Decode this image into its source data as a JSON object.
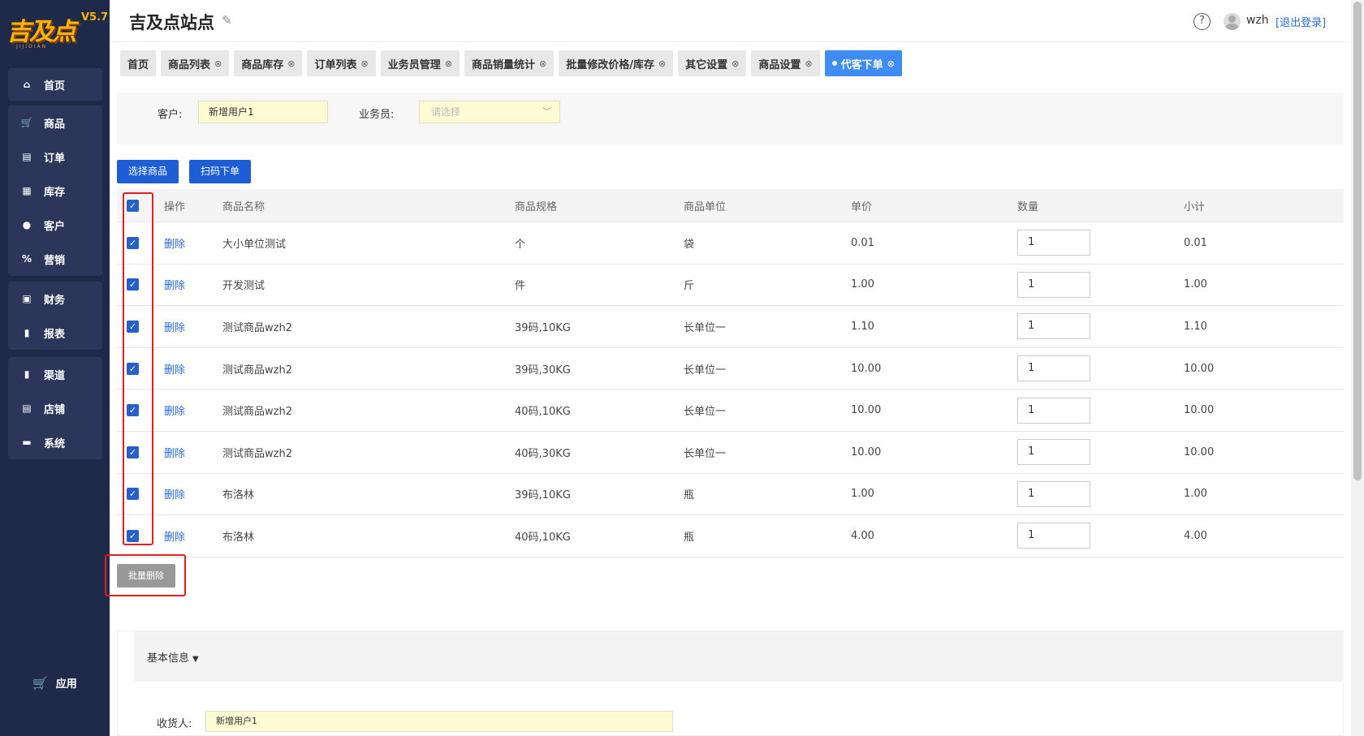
{
  "brand": {
    "logo_text": "吉及点",
    "version": "V5.7",
    "logo_sub": "JIJIDIAN"
  },
  "sidebar": {
    "home": {
      "label": "首页",
      "icon": "home-icon"
    },
    "group1": [
      {
        "label": "商品",
        "icon": "cart-icon"
      },
      {
        "label": "订单",
        "icon": "order-icon"
      },
      {
        "label": "库存",
        "icon": "grid-icon"
      },
      {
        "label": "客户",
        "icon": "user-icon"
      },
      {
        "label": "营销",
        "icon": "percent-icon"
      }
    ],
    "group2": [
      {
        "label": "财务",
        "icon": "finance-icon"
      },
      {
        "label": "报表",
        "icon": "bar-chart-icon"
      }
    ],
    "group3": [
      {
        "label": "渠道",
        "icon": "bar-chart-icon"
      },
      {
        "label": "店铺",
        "icon": "store-icon"
      },
      {
        "label": "系统",
        "icon": "monitor-icon"
      }
    ],
    "app": {
      "label": "应用",
      "icon": "cart-icon"
    }
  },
  "header": {
    "site_title": "吉及点站点",
    "help": "?",
    "username": "wzh",
    "logout": "[退出登录]"
  },
  "tabs": [
    {
      "label": "首页",
      "closable": false,
      "active": false
    },
    {
      "label": "商品列表",
      "closable": true,
      "active": false
    },
    {
      "label": "商品库存",
      "closable": true,
      "active": false
    },
    {
      "label": "订单列表",
      "closable": true,
      "active": false
    },
    {
      "label": "业务员管理",
      "closable": true,
      "active": false
    },
    {
      "label": "商品销量统计",
      "closable": true,
      "active": false
    },
    {
      "label": "批量修改价格/库存",
      "closable": true,
      "active": false
    },
    {
      "label": "其它设置",
      "closable": true,
      "active": false
    },
    {
      "label": "商品设置",
      "closable": true,
      "active": false
    },
    {
      "label": "代客下单",
      "closable": true,
      "active": true
    }
  ],
  "filter": {
    "customer_label": "客户:",
    "customer_value": "新增用户1",
    "salesman_label": "业务员:",
    "salesman_placeholder": "请选择"
  },
  "actions": {
    "select_goods": "选择商品",
    "scan_order": "扫码下单",
    "batch_delete": "批量删除"
  },
  "table": {
    "headers": {
      "op": "操作",
      "name": "商品名称",
      "spec": "商品规格",
      "unit": "商品单位",
      "price": "单价",
      "qty": "数量",
      "subtotal": "小计"
    },
    "delete_label": "删除",
    "rows": [
      {
        "name": "大小单位测试",
        "spec": "个",
        "unit": "袋",
        "price": "0.01",
        "qty": "1",
        "subtotal": "0.01"
      },
      {
        "name": "开发测试",
        "spec": "件",
        "unit": "斤",
        "price": "1.00",
        "qty": "1",
        "subtotal": "1.00"
      },
      {
        "name": "测试商品wzh2",
        "spec": "39码,10KG",
        "unit": "长单位一",
        "price": "1.10",
        "qty": "1",
        "subtotal": "1.10"
      },
      {
        "name": "测试商品wzh2",
        "spec": "39码,30KG",
        "unit": "长单位一",
        "price": "10.00",
        "qty": "1",
        "subtotal": "10.00"
      },
      {
        "name": "测试商品wzh2",
        "spec": "40码,10KG",
        "unit": "长单位一",
        "price": "10.00",
        "qty": "1",
        "subtotal": "10.00"
      },
      {
        "name": "测试商品wzh2",
        "spec": "40码,30KG",
        "unit": "长单位一",
        "price": "10.00",
        "qty": "1",
        "subtotal": "10.00"
      },
      {
        "name": "布洛林",
        "spec": "39码,10KG",
        "unit": "瓶",
        "price": "1.00",
        "qty": "1",
        "subtotal": "1.00"
      },
      {
        "name": "布洛林",
        "spec": "40码,10KG",
        "unit": "瓶",
        "price": "4.00",
        "qty": "1",
        "subtotal": "4.00"
      }
    ]
  },
  "basic_info": {
    "title": "基本信息",
    "receiver_label": "收货人:",
    "receiver_value": "新增用户1"
  },
  "colors": {
    "sidebar": "#1f2a4a",
    "primary": "#1d5ed6",
    "active_tab": "#3f8cf5",
    "highlight_box": "#e02020"
  }
}
